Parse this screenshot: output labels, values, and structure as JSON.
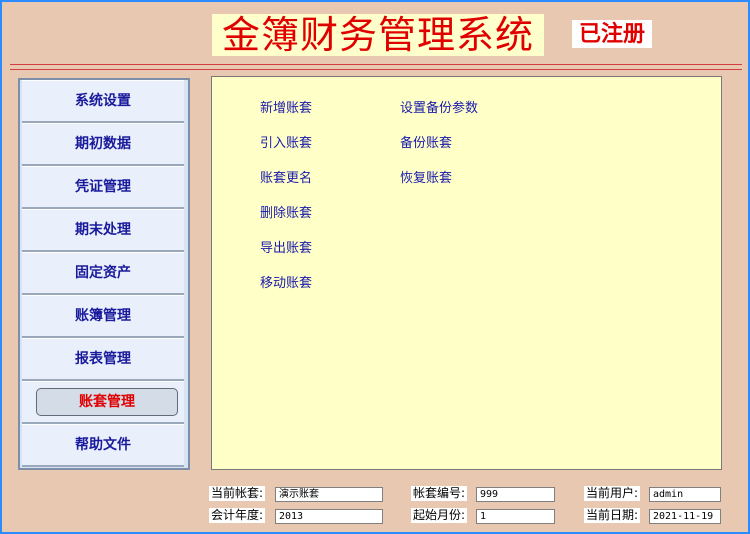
{
  "header": {
    "title": "金簿财务管理系统",
    "registered": "已注册"
  },
  "sidebar": {
    "items": [
      {
        "label": "系统设置"
      },
      {
        "label": "期初数据"
      },
      {
        "label": "凭证管理"
      },
      {
        "label": "期末处理"
      },
      {
        "label": "固定资产"
      },
      {
        "label": "账簿管理"
      },
      {
        "label": "报表管理"
      },
      {
        "label": "账套管理",
        "active": true
      },
      {
        "label": "帮助文件"
      }
    ]
  },
  "main": {
    "left_links": [
      "新增账套",
      "引入账套",
      "账套更名",
      "删除账套",
      "导出账套",
      "移动账套"
    ],
    "right_links": [
      "设置备份参数",
      "备份账套",
      "恢复账套"
    ]
  },
  "status": {
    "current_set_label": "当前帐套:",
    "current_set_value": "演示账套",
    "set_no_label": "帐套编号:",
    "set_no_value": "999",
    "current_user_label": "当前用户:",
    "current_user_value": "admin",
    "fiscal_year_label": "会计年度:",
    "fiscal_year_value": "2013",
    "start_month_label": "起始月份:",
    "start_month_value": "1",
    "current_date_label": "当前日期:",
    "current_date_value": "2021-11-19"
  },
  "colors": {
    "accent_border": "#2a8cff",
    "title_red": "#e00000",
    "panel_yellow": "#ffffc8",
    "link_blue": "#1a1aaa"
  }
}
